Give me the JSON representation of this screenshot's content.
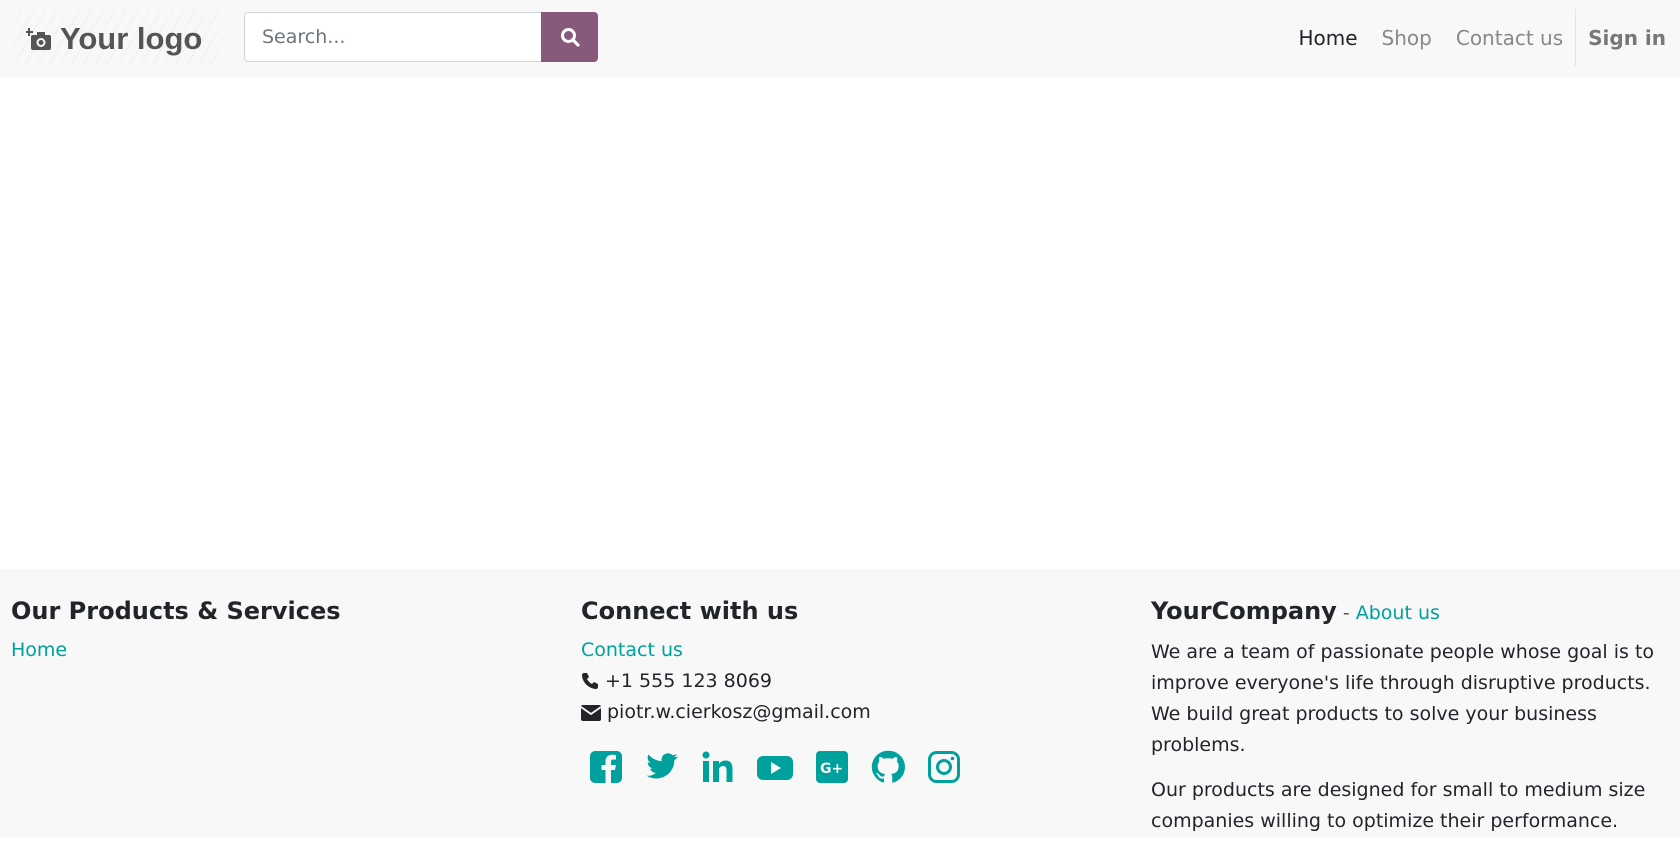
{
  "header": {
    "logo_text": "Your logo",
    "search_placeholder": "Search...",
    "nav": {
      "home": "Home",
      "shop": "Shop",
      "contact": "Contact us",
      "signin": "Sign in"
    }
  },
  "footer": {
    "col1": {
      "title": "Our Products & Services",
      "links": [
        "Home"
      ]
    },
    "col2": {
      "title": "Connect with us",
      "contact_link": "Contact us",
      "phone": "+1 555 123 8069",
      "email": "piotr.w.cierkosz@gmail.com",
      "social": [
        "facebook",
        "twitter",
        "linkedin",
        "youtube",
        "google-plus",
        "github",
        "instagram"
      ]
    },
    "col3": {
      "company": "YourCompany",
      "separator": " - ",
      "about_link": "About us",
      "paragraphs": [
        "We are a team of passionate people whose goal is to improve everyone's life through disruptive products. We build great products to solve your business problems.",
        "Our products are designed for small to medium size companies willing to optimize their performance."
      ]
    }
  },
  "colors": {
    "accent": "#00a09d",
    "brand": "#875a7b"
  }
}
